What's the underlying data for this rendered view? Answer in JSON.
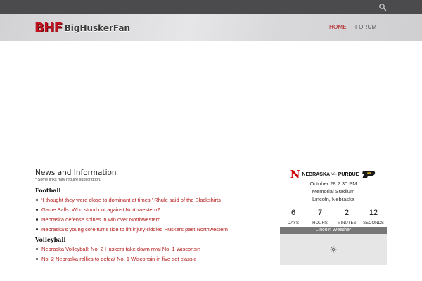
{
  "header": {
    "logo_mark": "BHF",
    "logo_name": "BigHuskerFan",
    "nav": [
      {
        "label": "HOME",
        "active": true
      },
      {
        "label": "FORUM",
        "active": false
      }
    ],
    "search_icon": "search-icon"
  },
  "news": {
    "title": "News and Information",
    "note": "* Some links may require subscription.",
    "categories": [
      {
        "name": "Football",
        "items": [
          "‘I thought they were close to dominant at times,’ Rhule said of the Blackshirts",
          "Game Balls: Who stood out against Northwestern?",
          "Nebraska defense shines in win over Northwestern",
          "Nebraska’s young core turns tide to lift injury-riddled Huskers past Northwestern"
        ]
      },
      {
        "name": "Volleyball",
        "items": [
          "Nebraska Volleyball: No. 2 Huskers take down rival No. 1 Wisconsin",
          "No. 2 Nebraska rallies to defeat No. 1 Wisconsin in five-set classic"
        ]
      }
    ]
  },
  "game": {
    "home_logo": "N",
    "home": "NEBRASKA",
    "vs": "vs.",
    "away": "PURDUE",
    "away_logo": "purdue-p-logo",
    "datetime": "October 28 2:30 PM",
    "venue": "Memorial Stadium",
    "city": "Lincoln, Nebraska",
    "countdown": [
      {
        "value": "6",
        "label": "DAYS"
      },
      {
        "value": "7",
        "label": "HOURS"
      },
      {
        "value": "2",
        "label": "MINUTES"
      },
      {
        "value": "12",
        "label": "SECONDS"
      }
    ]
  },
  "weather": {
    "title": "Lincoln Weather",
    "icon": "sun-loading-icon"
  },
  "colors": {
    "accent": "#b31b1b",
    "topbar": "#4b4b4d",
    "weather_header": "#777777"
  }
}
